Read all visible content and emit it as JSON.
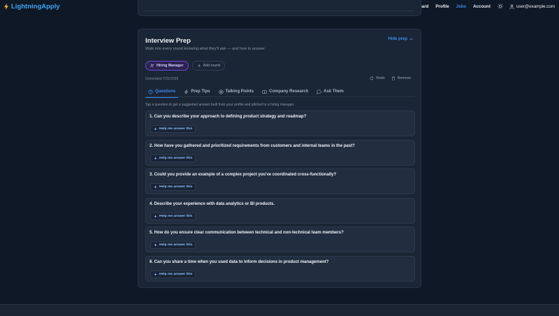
{
  "brand": {
    "name": "LightningApply",
    "color": "#3ea6f2"
  },
  "nav": {
    "links": [
      {
        "label": "Dashboard",
        "active": false
      },
      {
        "label": "Profile",
        "active": false
      },
      {
        "label": "Jobs",
        "active": true
      },
      {
        "label": "Account",
        "active": false
      }
    ],
    "theme_icon": "sun-icon",
    "user_email": "user@example.com"
  },
  "prep": {
    "title": "Interview Prep",
    "subtitle": "Walk into every round knowing what they'll ask — and how to answer.",
    "hide_label": "Hide prep",
    "rounds": [
      {
        "label": "Hiring Manager",
        "active": true
      }
    ],
    "add_round_label": "Add round",
    "generated": "Generated 7/31/2026",
    "redo_label": "Redo",
    "remove_label": "Remove",
    "tabs": [
      {
        "label": "Questions",
        "icon": "question-circle-icon",
        "active": true
      },
      {
        "label": "Prep Tips",
        "icon": "lightning-icon",
        "active": false
      },
      {
        "label": "Talking Points",
        "icon": "target-icon",
        "active": false
      },
      {
        "label": "Company Research",
        "icon": "book-icon",
        "active": false
      },
      {
        "label": "Ask Them",
        "icon": "chat-icon",
        "active": false
      }
    ],
    "hint": "Tap a question to get a suggested answer built from your profile and pitched to a hiring manager.",
    "help_label": "Help me answer this",
    "questions": [
      "1. Can you describe your approach to defining product strategy and roadmap?",
      "2. How have you gathered and prioritized requirements from customers and internal teams in the past?",
      "3. Could you provide an example of a complex project you've coordinated cross-functionally?",
      "4. Describe your experience with data analytics or BI products.",
      "5. How do you ensure clear communication between technical and non-technical team members?",
      "6. Can you share a time when you used data to inform decisions in product management?"
    ]
  },
  "colors": {
    "accent": "#3b8cf0",
    "round_active": "#6d4ad8",
    "background": "#0f1826",
    "card": "#1a2535"
  }
}
